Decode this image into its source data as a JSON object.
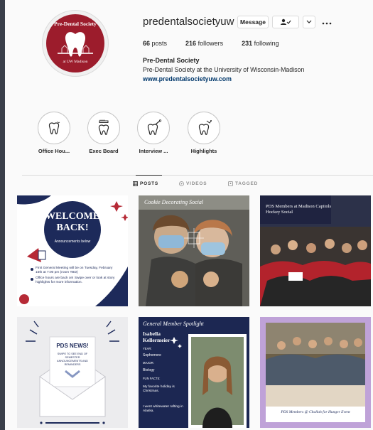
{
  "profile": {
    "username": "predentalsocietyuw",
    "message_label": "Message",
    "more_icon": "ellipsis-icon",
    "stats": {
      "posts_count": "66",
      "posts_label": "posts",
      "followers_count": "216",
      "followers_label": "followers",
      "following_count": "231",
      "following_label": "following"
    },
    "full_name": "Pre-Dental Society",
    "bio": "Pre-Dental Society at the University of Wisconsin-Madison",
    "website": "www.predentalsocietyuw.com",
    "avatar": {
      "title": "Pre-Dental Society",
      "subtitle": "at UW Madison"
    }
  },
  "highlights": [
    {
      "label": "Office Hou...",
      "icon": "tooth-icon"
    },
    {
      "label": "Exec Board",
      "icon": "toothbrush-tooth-icon"
    },
    {
      "label": "Interview ...",
      "icon": "tooth-tool-icon"
    },
    {
      "label": "Highlights",
      "icon": "tooth-sparkle-icon"
    }
  ],
  "tabs": [
    {
      "label": "POSTS",
      "active": true
    },
    {
      "label": "VIDEOS",
      "active": false
    },
    {
      "label": "TAGGED",
      "active": false
    }
  ],
  "posts": [
    {
      "id": "welcome",
      "heading": "WELCOME BACK!",
      "subheading": "Announcements below",
      "bullets": [
        "First General Meeting will be on Tuesday, February 15th at 7:00 pm (room TBD)",
        "Office hours are back on! Swipe over or look at story highlights for more information."
      ]
    },
    {
      "id": "cookie",
      "caption": "Cookie Decorating Social"
    },
    {
      "id": "hockey",
      "caption": "PDS Members at Madison Capitols Hockey Social"
    },
    {
      "id": "news",
      "heading": "PDS NEWS!",
      "subheading": "SWIPE TO SEE END OF SEMESTER ANNOUNCEMENTS AND REMINDERS"
    },
    {
      "id": "spotlight",
      "heading": "General Member Spotlight",
      "name": "Isabella Kellermeier",
      "year_label": "YEAR:",
      "year": "Sophomore",
      "major_label": "MAJOR:",
      "major": "Biology",
      "funfacts_label": "FUN FACTS:",
      "fact1": "My favorite holiday is Christmas.",
      "fact2": "I went whitewater rafting in Alaska."
    },
    {
      "id": "challah",
      "caption": "PDS Members @ Challah for Hunger Event"
    }
  ],
  "colors": {
    "brand_red": "#9c1c2c",
    "navy": "#1d2a5a",
    "link": "#00376b"
  }
}
